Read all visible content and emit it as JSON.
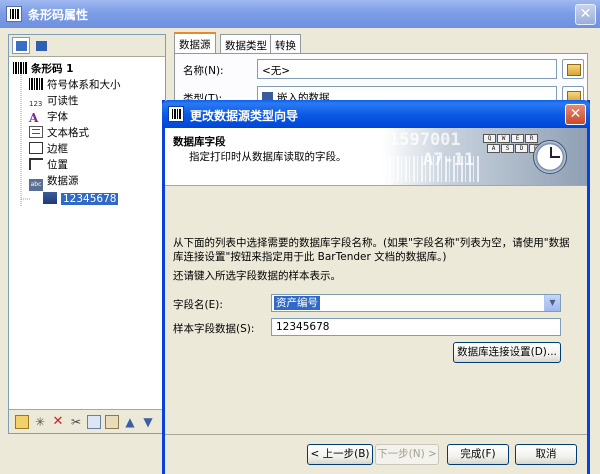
{
  "outer": {
    "title": "条形码属性",
    "close": "✕",
    "tree": [
      {
        "label": "条形码 1",
        "icon": "barcode-icon",
        "prefix": "123"
      },
      {
        "label": "符号体系和大小",
        "icon": "barcode-icon"
      },
      {
        "label": "可读性",
        "icon": "readable-123-icon",
        "prefix": "123"
      },
      {
        "label": "字体",
        "icon": "font-a-icon",
        "prefix": "A"
      },
      {
        "label": "文本格式",
        "icon": "text-format-icon"
      },
      {
        "label": "边框",
        "icon": "border-icon"
      },
      {
        "label": "位置",
        "icon": "position-icon"
      },
      {
        "label": "数据源",
        "icon": "datasource-icon",
        "prefix": "abc"
      },
      {
        "label": "12345678",
        "icon": "database-icon"
      }
    ],
    "tabs": [
      "数据源",
      "数据类型",
      "转换"
    ],
    "name_label": "名称(N):",
    "name_value": "<无>",
    "type_label": "类型(T):",
    "type_value": "嵌入的数据"
  },
  "wizard": {
    "title": "更改数据源类型向导",
    "close": "✕",
    "header_title": "数据库字段",
    "header_subtitle": "指定打印时从数据库读取的字段。",
    "art_text_1": "1597001",
    "art_text_2": "A7-11",
    "keys": [
      "Q",
      "W",
      "E",
      "R",
      "T",
      "Y",
      "A",
      "S",
      "D",
      "F",
      "G",
      "H"
    ],
    "description": "从下面的列表中选择需要的数据库字段名称。(如果\"字段名称\"列表为空，请使用\"数据库连接设置\"按钮来指定用于此 BarTender 文档的数据库。)",
    "sample_note": "还请键入所选字段数据的样本表示。",
    "field_name_label": "字段名(E):",
    "field_name_value": "资产编号",
    "sample_label": "样本字段数据(S):",
    "sample_value": "12345678",
    "db_settings_button": "数据库连接设置(D)...",
    "back_button": "< 上一步(B)",
    "next_button": "下一步(N) >",
    "finish_button": "完成(F)",
    "cancel_button": "取消"
  }
}
